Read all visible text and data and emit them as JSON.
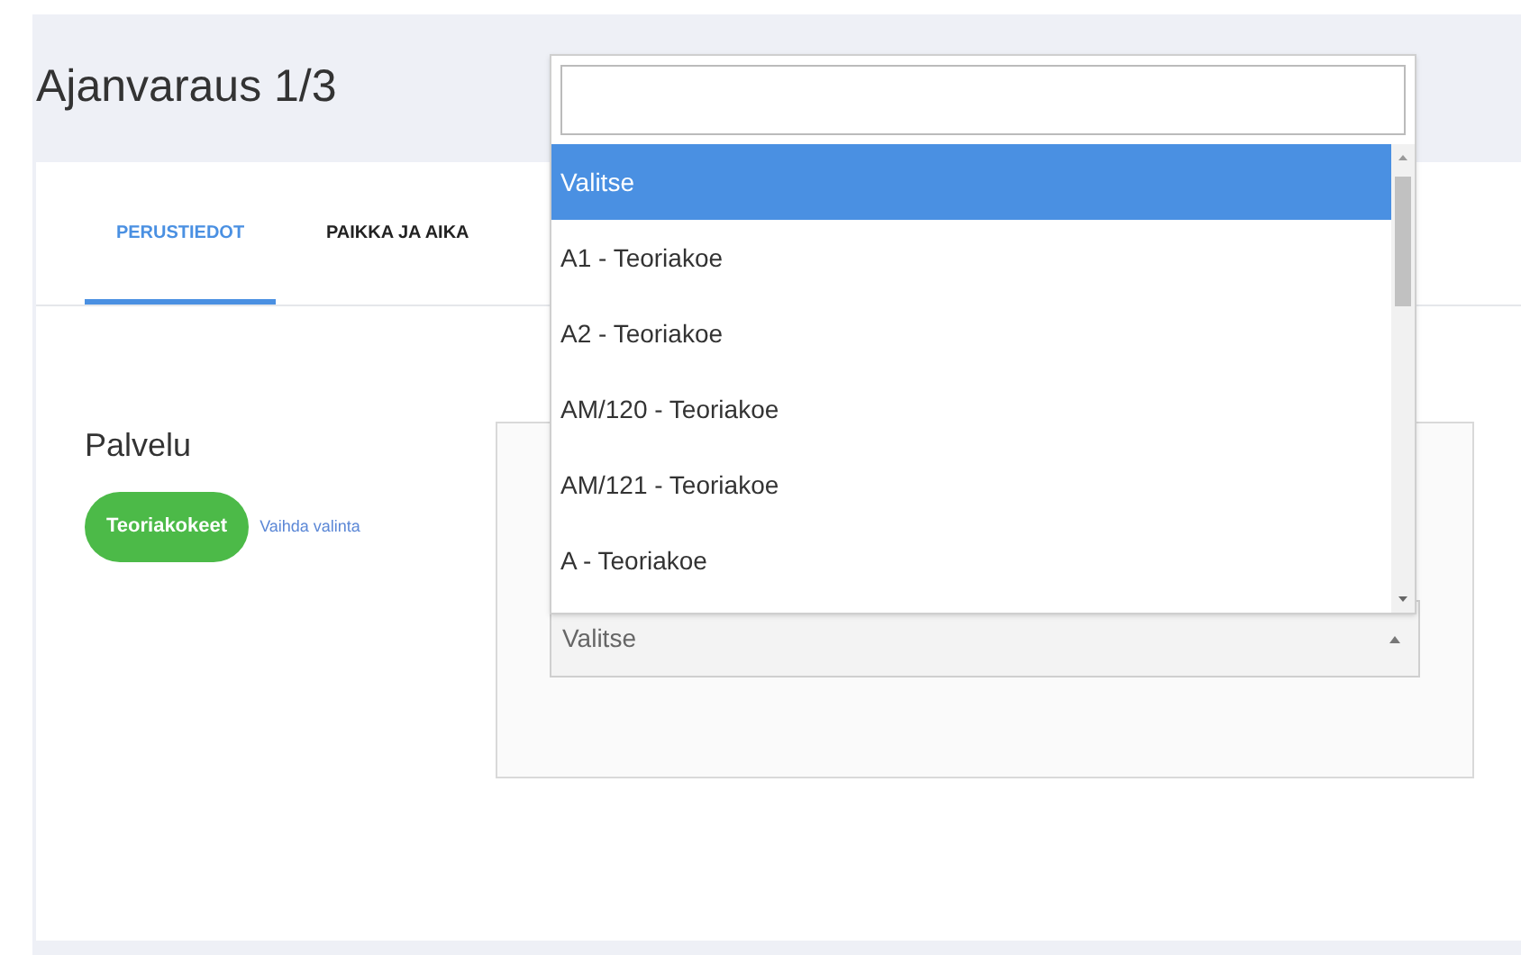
{
  "page": {
    "title": "Ajanvaraus 1/3"
  },
  "tabs": [
    {
      "label": "PERUSTIEDOT",
      "selected": true
    },
    {
      "label": "PAIKKA JA AIKA",
      "selected": false
    }
  ],
  "service": {
    "label": "Palvelu",
    "chip": "Teoriakokeet",
    "change_link": "Vaihda valinta"
  },
  "select": {
    "value": "Valitse",
    "expanded": true,
    "options": [
      {
        "label": "Valitse",
        "selected": true
      },
      {
        "label": "A1 - Teoriakoe",
        "selected": false
      },
      {
        "label": "A2 - Teoriakoe",
        "selected": false
      },
      {
        "label": "AM/120 - Teoriakoe",
        "selected": false
      },
      {
        "label": "AM/121 - Teoriakoe",
        "selected": false
      },
      {
        "label": "A - Teoriakoe",
        "selected": false
      }
    ]
  }
}
